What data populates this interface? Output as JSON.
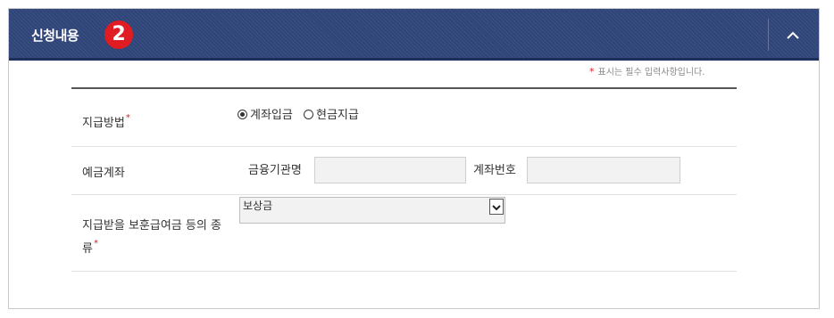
{
  "section": {
    "title": "신청내용",
    "step": "2"
  },
  "required_note": {
    "star": "*",
    "text": "표시는 필수 입력사항입니다."
  },
  "form": {
    "payment_method": {
      "label": "지급방법",
      "required_mark": "*",
      "options": [
        {
          "label": "계좌입금",
          "selected": true
        },
        {
          "label": "현금지급",
          "selected": false
        }
      ]
    },
    "deposit_account": {
      "label": "예금계좌",
      "bank_label": "금융기관명",
      "bank_value": "",
      "account_label": "계좌번호",
      "account_value": ""
    },
    "benefit_type": {
      "label_line1": "지급받을 보훈급여금 등의 종",
      "label_line2": "류",
      "required_mark": "*",
      "selected": "보상금"
    }
  },
  "icons": {
    "collapse": "chevron-up-icon",
    "select_arrow": "chevron-down-icon"
  },
  "colors": {
    "header_bg": "#2f4478",
    "badge": "#e11b22",
    "required": "#e11b22"
  }
}
